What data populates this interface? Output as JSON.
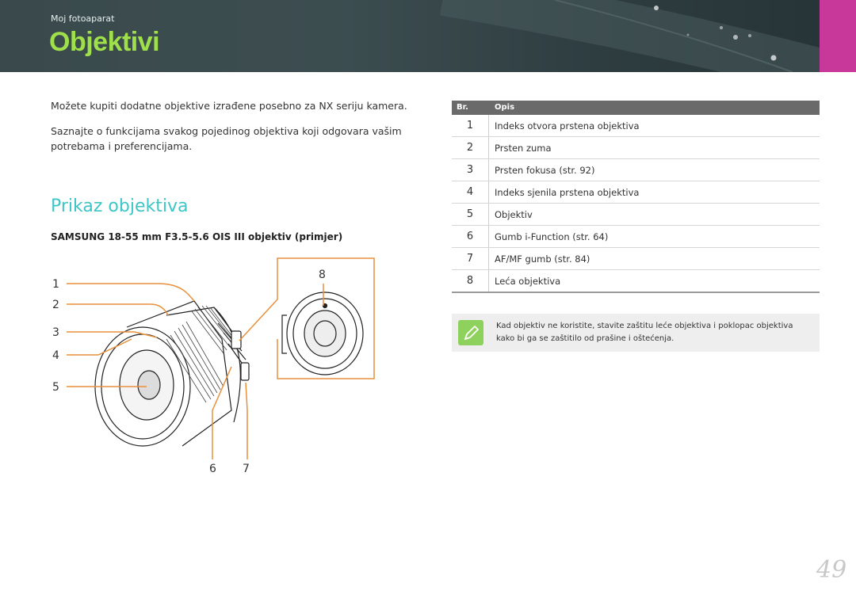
{
  "header": {
    "breadcrumb": "Moj fotoaparat",
    "title": "Objektivi",
    "accent_color": "#9fe04a",
    "tab_color": "#c8379a"
  },
  "intro": {
    "paragraph_1": "Možete kupiti dodatne objektive izrađene posebno za NX seriju kamera.",
    "paragraph_2": "Saznajte o funkcijama svakog pojedinog objektiva koji odgovara vašim potrebama i preferencijama."
  },
  "section": {
    "title": "Prikaz objektiva",
    "subtitle": "SAMSUNG 18-55 mm F3.5-5.6 OIS III objektiv (primjer)"
  },
  "figure": {
    "callouts": [
      "1",
      "2",
      "3",
      "4",
      "5",
      "6",
      "7",
      "8"
    ],
    "callout_color": "#e8903c"
  },
  "table": {
    "headers": {
      "number": "Br.",
      "description": "Opis"
    },
    "rows": [
      {
        "num": "1",
        "desc": "Indeks otvora prstena objektiva"
      },
      {
        "num": "2",
        "desc": "Prsten zuma"
      },
      {
        "num": "3",
        "desc": "Prsten fokusa (str. 92)"
      },
      {
        "num": "4",
        "desc": "Indeks sjenila prstena objektiva"
      },
      {
        "num": "5",
        "desc": "Objektiv"
      },
      {
        "num": "6",
        "desc": "Gumb i-Function (str. 64)"
      },
      {
        "num": "7",
        "desc": "AF/MF gumb (str. 84)"
      },
      {
        "num": "8",
        "desc": "Leća objektiva"
      }
    ]
  },
  "note": {
    "icon": "pencil-icon",
    "text": "Kad objektiv ne koristite, stavite zaštitu leće objektiva i poklopac objektiva kako bi ga se zaštitilo od prašine i oštećenja."
  },
  "page_number": "49"
}
